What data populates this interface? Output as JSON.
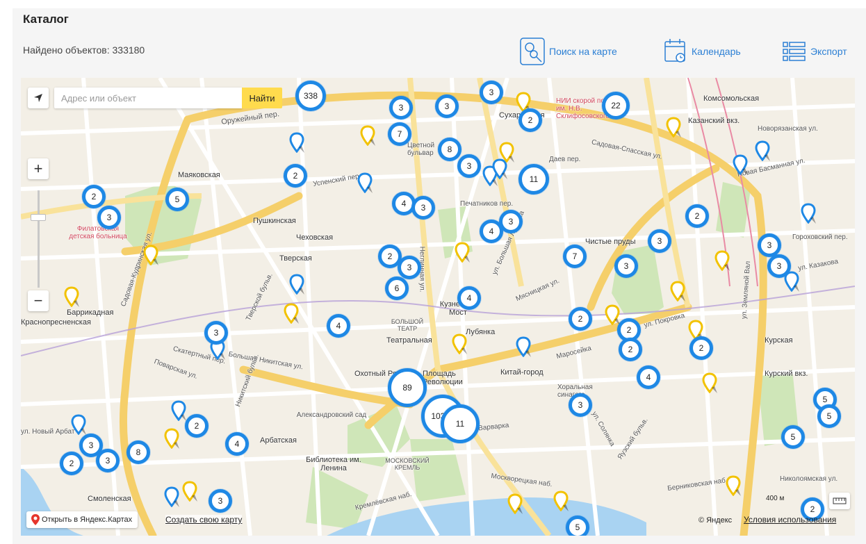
{
  "header": {
    "title": "Каталог",
    "found_label": "Найдено объектов: 333180"
  },
  "toolbar": {
    "map_search_label": "Поиск на карте",
    "calendar_label": "Календарь",
    "export_label": "Экспорт"
  },
  "map": {
    "search": {
      "placeholder": "Адрес или объект",
      "button_label": "Найти"
    },
    "zoom_in_label": "+",
    "zoom_out_label": "−",
    "open_yandex_label": "Открыть в Яндекс.Картах",
    "create_map_label": "Создать свою карту",
    "scale_label": "400 м",
    "copyright_label": "© Яндекс",
    "terms_label": "Условия использования",
    "colors": {
      "cluster": "#1e88e5",
      "pin_blue": "#1e88e5",
      "pin_yellow": "#f2c200",
      "search_button": "#ffdb4d",
      "link": "#2b7fd4"
    },
    "clusters": [
      "338",
      "3",
      "3",
      "3",
      "22",
      "2",
      "7",
      "8",
      "3",
      "2",
      "11",
      "5",
      "2",
      "3",
      "4",
      "3",
      "3",
      "4",
      "2",
      "3",
      "3",
      "3",
      "7",
      "3",
      "2",
      "3",
      "6",
      "4",
      "2",
      "3",
      "4",
      "2",
      "2",
      "2",
      "4",
      "89",
      "10327",
      "11",
      "3",
      "5",
      "5",
      "2",
      "4",
      "5",
      "3",
      "8",
      "3",
      "2",
      "2",
      "3",
      "5"
    ],
    "labels": {
      "komsomolskaya": "Комсомольская",
      "kazansky": "Казанский вкз.",
      "novoryazanskaya": "Новорязанская ул.",
      "sukharevskaya": "Сухаревская",
      "nii": "НИИ скорой помощи им. Н.В. Склифосовского",
      "daev": "Даев пер.",
      "sadovaya_spasskaya": "Садовая-Спасская ул.",
      "oruzheyny": "Оружейный пер.",
      "mayakovskaya": "Маяковская",
      "tsvetnoy": "Цветной бульвар",
      "uspensky": "Успенский пер.",
      "pushkinskaya": "Пушкинская",
      "chekhovskaya": "Чеховская",
      "tverskaya": "Тверская",
      "filatovskaya": "Филатовская детская больница",
      "barrikadnaya": "Баррикадная",
      "krasnopresnenskaya": "Краснопресненская",
      "kuznetsky": "Кузнецкий Мост",
      "bolshoy": "БОЛЬШОЙ ТЕАТР",
      "teatralnaya": "Театральная",
      "lubyanka": "Лубянка",
      "chistye": "Чистые пруды",
      "kurskaya": "Курская",
      "kursky": "Курский вкз.",
      "kitay_gorod": "Китай-город",
      "okhotny": "Охотный Ряд",
      "ploshchad": "Площадь Революции",
      "aleksandrovsky": "Александровский сад",
      "arbatskaya": "Арбатская",
      "biblioteka": "Библиотека им. Ленина",
      "kremlin": "МОСКОВСКИЙ КРЕМЛЬ",
      "smolenskaya": "Смоленская",
      "khoralnaya": "Хоральная синагога",
      "varvarka": "ул. Варварка",
      "zemlyanoy": "ул. Земляной Вал",
      "bolshaya_nikitskaya": "Большая Никитская ул.",
      "nikolo": "Николоямская ул.",
      "bersenevskaya": "Берниковская наб.",
      "moskvoretskaya": "Москворецкая наб.",
      "kremlevskaya": "Кремлёвская наб.",
      "novy_arbat": "ул. Новый Арбат",
      "basmannaya": "Новая Басманная ул.",
      "gorokhovsky": "Гороховский пер.",
      "kazakova": "ул. Казакова",
      "pokrovka": "ул. Покровка",
      "myasnitskaya": "Мясницкая ул.",
      "neglinnaya": "Неглинная ул.",
      "bolshaya_lubyanka": "ул. Большая Лубянка",
      "sadovaya_kudrinskaya": "Садовая-Кудринская ул.",
      "povarskaya": "Поварская ул.",
      "skaterny": "Скатертный пер.",
      "tverskoy": "Тверской бульв.",
      "nikitsky": "Никитский бульв.",
      "maroseyka": "Маросейка",
      "solyanka": "ул. Солянка",
      "yauzsky": "Яузский бульв.",
      "pechatnikov": "Печатников пер."
    }
  }
}
